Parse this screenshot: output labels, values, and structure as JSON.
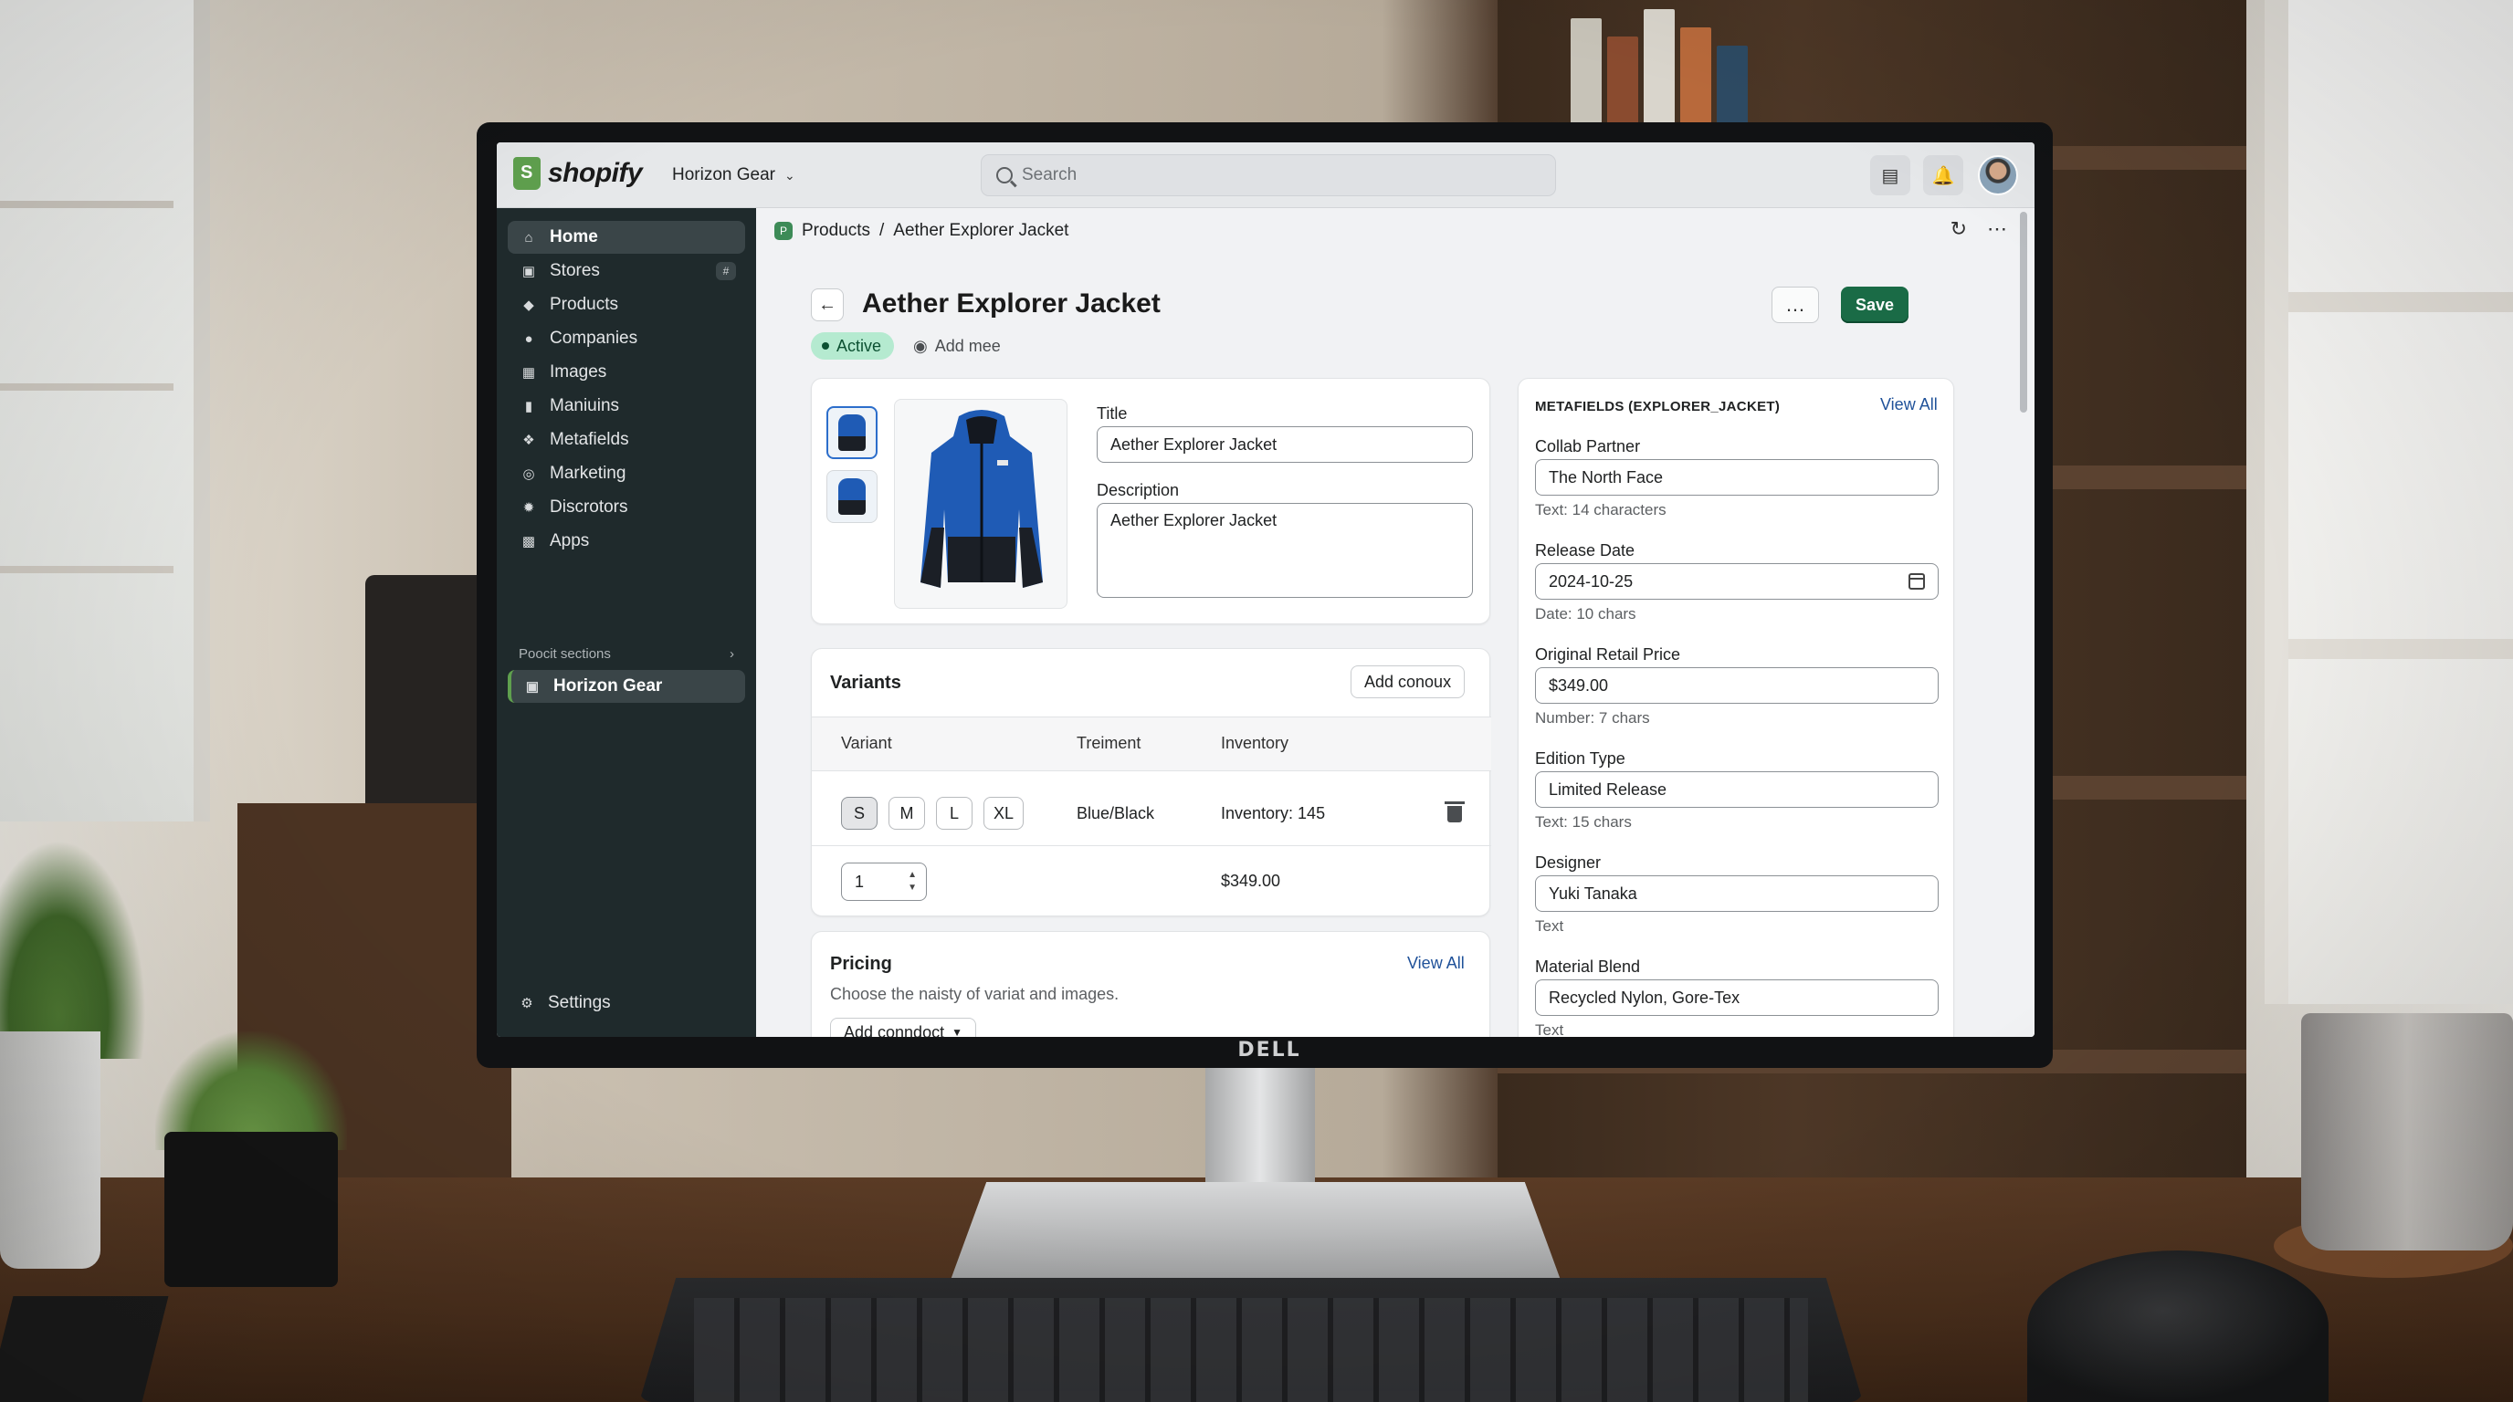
{
  "brand": {
    "logo_text": "shopify",
    "accent": "#1a6b46",
    "sidebar_bg": "#1f2a2c"
  },
  "topbar": {
    "store_name": "Horizon Gear",
    "search_placeholder": "Search",
    "icons": [
      "store-icon",
      "bell-icon",
      "avatar"
    ]
  },
  "sidebar": {
    "items": [
      {
        "label": "Home",
        "icon": "home-icon",
        "active": true
      },
      {
        "label": "Stores",
        "icon": "store-icon",
        "badge": "#"
      },
      {
        "label": "Products",
        "icon": "tag-icon"
      },
      {
        "label": "Companies",
        "icon": "person-icon"
      },
      {
        "label": "Images",
        "icon": "image-icon"
      },
      {
        "label": "Maniuins",
        "icon": "bar-chart-icon"
      },
      {
        "label": "Metafields",
        "icon": "metafield-icon"
      },
      {
        "label": "Marketing",
        "icon": "target-icon"
      },
      {
        "label": "Discrotors",
        "icon": "discount-icon"
      },
      {
        "label": "Apps",
        "icon": "apps-icon"
      }
    ],
    "section_label": "Poocit sections",
    "channel": "Horizon Gear",
    "settings_label": "Settings"
  },
  "breadcrumb": {
    "root": "Products",
    "separator": "/",
    "current": "Aether Explorer Jacket"
  },
  "page": {
    "title": "Aether Explorer Jacket",
    "status": "Active",
    "add_meta": "Add mee",
    "more": "…",
    "save": "Save"
  },
  "product": {
    "title_label": "Title",
    "title_value": "Aether Explorer Jacket",
    "description_label": "Description",
    "description_value": "Aether Explorer Jacket"
  },
  "variants": {
    "title": "Variants",
    "add_button": "Add conoux",
    "headers": [
      "Variant",
      "Treiment",
      "Inventory"
    ],
    "sizes": [
      "S",
      "M",
      "L",
      "XL"
    ],
    "selected_size": "S",
    "treatment": "Blue/Black",
    "inventory": "Inventory: 145",
    "quantity": "1",
    "price": "$349.00"
  },
  "pricing": {
    "title": "Pricing",
    "view_all": "View All",
    "subtitle": "Choose the naisty of variat and images.",
    "add_button": "Add conndoct"
  },
  "metafields": {
    "header": "METAFIELDS (EXPLORER_JACKET)",
    "view_all": "View All",
    "fields": [
      {
        "label": "Collab Partner",
        "value": "The North Face",
        "hint": "Text: 14 characters"
      },
      {
        "label": "Release Date",
        "value": "2024-10-25",
        "hint": "Date: 10 chars",
        "calendar": true
      },
      {
        "label": "Original Retail Price",
        "value": "$349.00",
        "hint": "Number: 7 chars"
      },
      {
        "label": "Edition Type",
        "value": "Limited Release",
        "hint": "Text: 15 chars"
      },
      {
        "label": "Designer",
        "value": "Yuki Tanaka",
        "hint": "Text"
      },
      {
        "label": "Material Blend",
        "value": "Recycled Nylon, Gore-Tex",
        "hint": "Text"
      }
    ]
  },
  "monitor": {
    "brand": "DELL"
  }
}
